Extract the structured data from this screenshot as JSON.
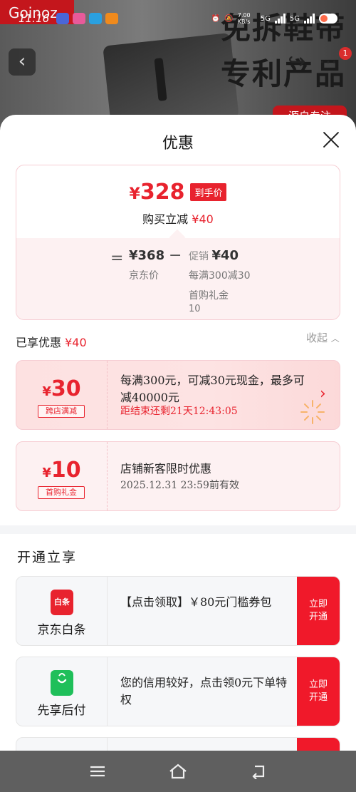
{
  "status_bar": {
    "time": "11:16",
    "net_speed": "7.00 KB/s",
    "signal_1": "5G",
    "signal_2": "5G",
    "battery": "56"
  },
  "background_page": {
    "headline_line1": "免拆鞋带",
    "headline_line2": "专利产品",
    "logo_text": "Goinoz",
    "red_pill_text": "源自专注",
    "notif_count": "1"
  },
  "sheet": {
    "title": "优惠"
  },
  "price_summary": {
    "currency": "¥",
    "final_price": "328",
    "final_badge": "到手价",
    "instant_label": "购买立减",
    "instant_amount": "¥40",
    "eq_sign": "=",
    "jd_price": "¥368",
    "jd_label": "京东价",
    "minus_sign": "−",
    "promo_label": "促销",
    "promo_amount": "¥40",
    "promo_desc": "每满300减30",
    "gift_label": "首购礼金",
    "gift_value": "10"
  },
  "enjoyed": {
    "label": "已享优惠",
    "amount": "¥40",
    "collapse_label": "收起"
  },
  "coupons": [
    {
      "amount": "30",
      "tag": "跨店满减",
      "text": "每满300元，可减30元现金，最多可减40000元",
      "sub": "距结束还剩21天12:43:05"
    },
    {
      "amount": "10",
      "tag": "首购礼金",
      "text": "店铺新客限时优惠",
      "sub": "2025.12.31 23:59前有效"
    }
  ],
  "open_section": {
    "title": "开通立享",
    "services": [
      {
        "name": "京东白条",
        "logo_text": "白条",
        "logo_color": "#e8232e",
        "desc": "【点击领取】￥80元门槛券包",
        "button": "立即开通"
      },
      {
        "name": "先享后付",
        "logo_text": "",
        "logo_color": "#1fbf5a",
        "desc": "您的信用较好，点击领0元下单特权",
        "button": "立即开通"
      }
    ]
  },
  "colors": {
    "accent_red": "#e8232e",
    "button_red": "#f0192a",
    "service_green": "#1fbf5a"
  }
}
